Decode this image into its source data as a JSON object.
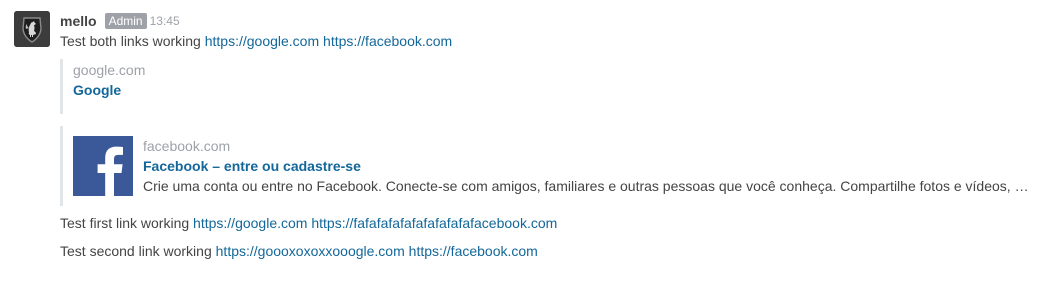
{
  "message": {
    "username": "mello",
    "role": "Admin",
    "time": "13:45",
    "avatar_icon": "rooster-shield-icon",
    "line1": {
      "text": "Test both links working",
      "links": [
        "https://google.com",
        "https://facebook.com"
      ]
    },
    "preview_google": {
      "host": "google.com",
      "title": "Google"
    },
    "preview_facebook": {
      "host": "facebook.com",
      "title": "Facebook – entre ou cadastre-se",
      "description": "Crie uma conta ou entre no Facebook. Conecte-se com amigos, familiares e outras pessoas que você conheça. Compartilhe fotos e vídeos, …",
      "thumbnail_icon": "facebook-logo-icon",
      "thumbnail_color": "#3b5998"
    },
    "line3": {
      "text": "Test first link working",
      "links": [
        "https://google.com",
        "https://fafafafafafafafafafafacebook.com"
      ]
    },
    "line4": {
      "text": "Test second link working",
      "links": [
        "https://goooxoxoxxooogle.com",
        "https://facebook.com"
      ]
    }
  },
  "colors": {
    "link": "#13679a",
    "badge": "#9ea2a8",
    "text": "#444444",
    "muted": "#9ea2a8",
    "quote_border": "#e1e5e8"
  }
}
